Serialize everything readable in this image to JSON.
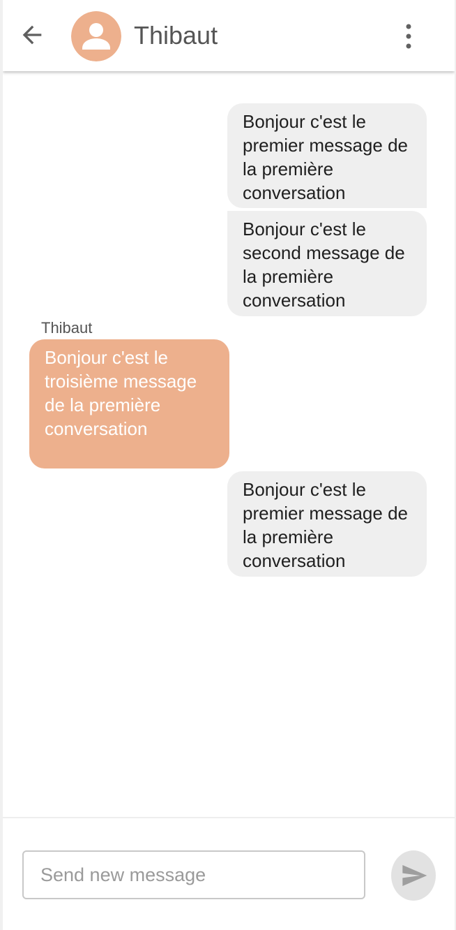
{
  "header": {
    "contact_name": "Thibaut",
    "back_icon": "arrow-left-icon",
    "avatar_icon": "person-icon",
    "menu_icon": "more-vertical-icon",
    "avatar_color": "#edb08d"
  },
  "messages": [
    {
      "direction": "outgoing",
      "text": "Bonjour c'est le premier message de la première conversation"
    },
    {
      "direction": "outgoing",
      "text": "Bonjour c'est le second message de la première conversation"
    },
    {
      "direction": "incoming",
      "sender": "Thibaut",
      "text": "Bonjour c'est le troisième message de la première conversation"
    },
    {
      "direction": "outgoing",
      "text": "Bonjour c'est le premier message de la première conversation"
    }
  ],
  "composer": {
    "value": "",
    "placeholder": "Send new message",
    "send_icon": "send-icon"
  },
  "colors": {
    "accent": "#edb08d",
    "outgoing_bubble": "#efefef",
    "send_button": "#e2e2e2"
  }
}
